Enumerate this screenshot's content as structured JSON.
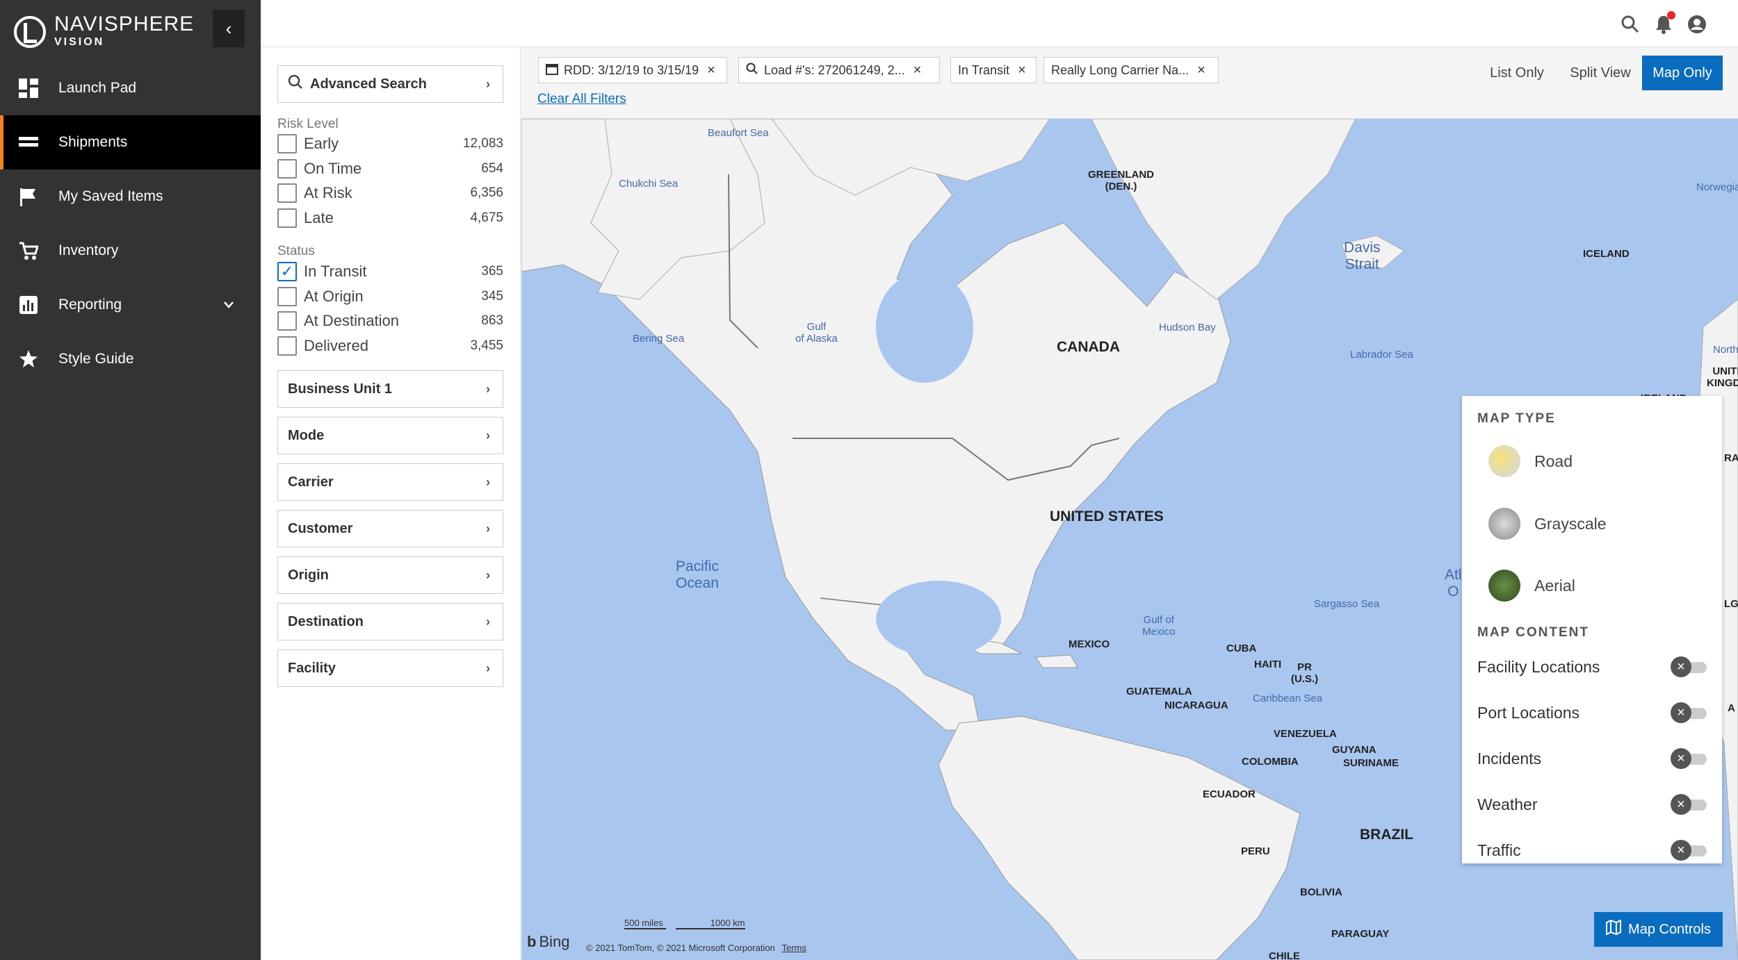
{
  "app": {
    "brand_name": "NAVISPHERE",
    "brand_sub": "VISION"
  },
  "icons": {
    "collapse": "chevron-left-icon",
    "search": "search-icon",
    "bell": "bell-icon",
    "user": "user-icon"
  },
  "sidebar": {
    "items": [
      {
        "label": "Launch Pad",
        "icon": "dashboard-icon"
      },
      {
        "label": "Shipments",
        "icon": "shipments-icon",
        "active": true
      },
      {
        "label": "My Saved Items",
        "icon": "flag-icon"
      },
      {
        "label": "Inventory",
        "icon": "cart-icon"
      },
      {
        "label": "Reporting",
        "icon": "chart-icon",
        "expandable": true
      },
      {
        "label": "Style Guide",
        "icon": "star-icon"
      }
    ]
  },
  "filters": {
    "advanced_search": "Advanced Search",
    "risk_level": {
      "label": "Risk Level",
      "options": [
        {
          "label": "Early",
          "count": "12,083",
          "checked": false
        },
        {
          "label": "On Time",
          "count": "654",
          "checked": false
        },
        {
          "label": "At Risk",
          "count": "6,356",
          "checked": false
        },
        {
          "label": "Late",
          "count": "4,675",
          "checked": false
        }
      ]
    },
    "status": {
      "label": "Status",
      "options": [
        {
          "label": "In Transit",
          "count": "365",
          "checked": true
        },
        {
          "label": "At Origin",
          "count": "345",
          "checked": false
        },
        {
          "label": "At Destination",
          "count": "863",
          "checked": false
        },
        {
          "label": "Delivered",
          "count": "3,455",
          "checked": false
        }
      ]
    },
    "accordions": [
      "Business Unit 1",
      "Mode",
      "Carrier",
      "Customer",
      "Origin",
      "Destination",
      "Facility"
    ]
  },
  "active_filters": {
    "chips": [
      {
        "label": "RDD: 3/12/19 to 3/15/19",
        "icon": "calendar-icon"
      },
      {
        "label": "Load #'s: 272061249, 2...",
        "icon": "search-icon"
      },
      {
        "label": "In Transit"
      },
      {
        "label": "Really Long Carrier Na..."
      }
    ],
    "clear_all": "Clear All Filters"
  },
  "views": {
    "options": [
      "List Only",
      "Split View",
      "Map Only"
    ],
    "selected": "Map Only"
  },
  "map": {
    "labels": {
      "beaufort": "Beaufort Sea",
      "chukchi": "Chukchi Sea",
      "greenland": "GREENLAND\n(DEN.)",
      "norwegian": "Norwegian",
      "davis": "Davis\nStrait",
      "iceland": "ICELAND",
      "bering": "Bering Sea",
      "gulf_alaska": "Gulf\nof Alaska",
      "canada": "CANADA",
      "hudson": "Hudson Bay",
      "labrador": "Labrador Sea",
      "north": "North",
      "uk": "UNITED\nKINGDOM",
      "ireland": "IRELAND",
      "us": "UNITED STATES",
      "pacific": "Pacific\nOcean",
      "atlantic": "Atl\nO",
      "sargasso": "Sargasso Sea",
      "gulf_mexico": "Gulf of\nMexico",
      "mexico": "MEXICO",
      "cuba": "CUBA",
      "haiti": "HAITI",
      "pr": "PR\n(U.S.)",
      "guatemala": "GUATEMALA",
      "nicaragua": "NICARAGUA",
      "caribbean": "Caribbean Sea",
      "venezuela": "VENEZUELA",
      "guyana": "GUYANA",
      "suriname": "SURINAME",
      "colombia": "COLOMBIA",
      "ecuador": "ECUADOR",
      "brazil": "BRAZIL",
      "peru": "PERU",
      "bolivia": "BOLIVIA",
      "paraguay": "PARAGUAY",
      "chile": "CHILE",
      "rai": "RAI",
      "lge": "LGE",
      "a": "A"
    },
    "scale_miles": "500 miles",
    "scale_km": "1000 km",
    "provider": "Bing",
    "copyright": "© 2021 TomTom, © 2021 Microsoft Corporation",
    "terms": "Terms"
  },
  "map_controls": {
    "map_type_label": "MAP TYPE",
    "map_types": [
      {
        "label": "Road",
        "icon": "road-map-icon"
      },
      {
        "label": "Grayscale",
        "icon": "grayscale-map-icon"
      },
      {
        "label": "Aerial",
        "icon": "aerial-map-icon"
      }
    ],
    "map_content_label": "MAP CONTENT",
    "content": [
      {
        "label": "Facility Locations",
        "on": false
      },
      {
        "label": "Port Locations",
        "on": false
      },
      {
        "label": "Incidents",
        "on": false
      },
      {
        "label": "Weather",
        "on": false
      },
      {
        "label": "Traffic",
        "on": false
      }
    ],
    "button_label": "Map Controls"
  },
  "colors": {
    "accent": "#0a6cbf",
    "sidebar": "#333333",
    "active_bar": "#f58220",
    "water": "#a9c6ef",
    "land": "#f2f2f2"
  }
}
